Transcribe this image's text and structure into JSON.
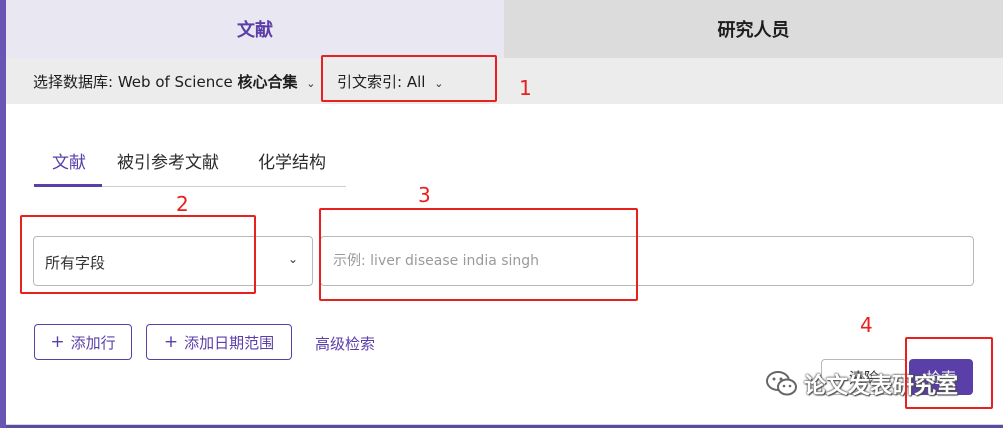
{
  "top_tabs": {
    "literature": "文献",
    "researchers": "研究人员"
  },
  "database_bar": {
    "label": "选择数据库:",
    "db_name_plain": "Web of Science",
    "db_name_bold": "核心合集",
    "citation_index": "引文索引: All"
  },
  "sub_tabs": [
    "文献",
    "被引参考文献",
    "化学结构"
  ],
  "search_row": {
    "field_select": "所有字段",
    "query_placeholder": "示例: liver disease india singh"
  },
  "actions": {
    "add_row": "添加行",
    "add_date_range": "添加日期范围",
    "advanced_search": "高级检索",
    "clear": "清除",
    "search": "检索"
  },
  "annotations": [
    "1",
    "2",
    "3",
    "4"
  ],
  "watermark": "论文发表研究室",
  "colors": {
    "accent": "#5a3fa9",
    "annotation": "#e8201e"
  }
}
